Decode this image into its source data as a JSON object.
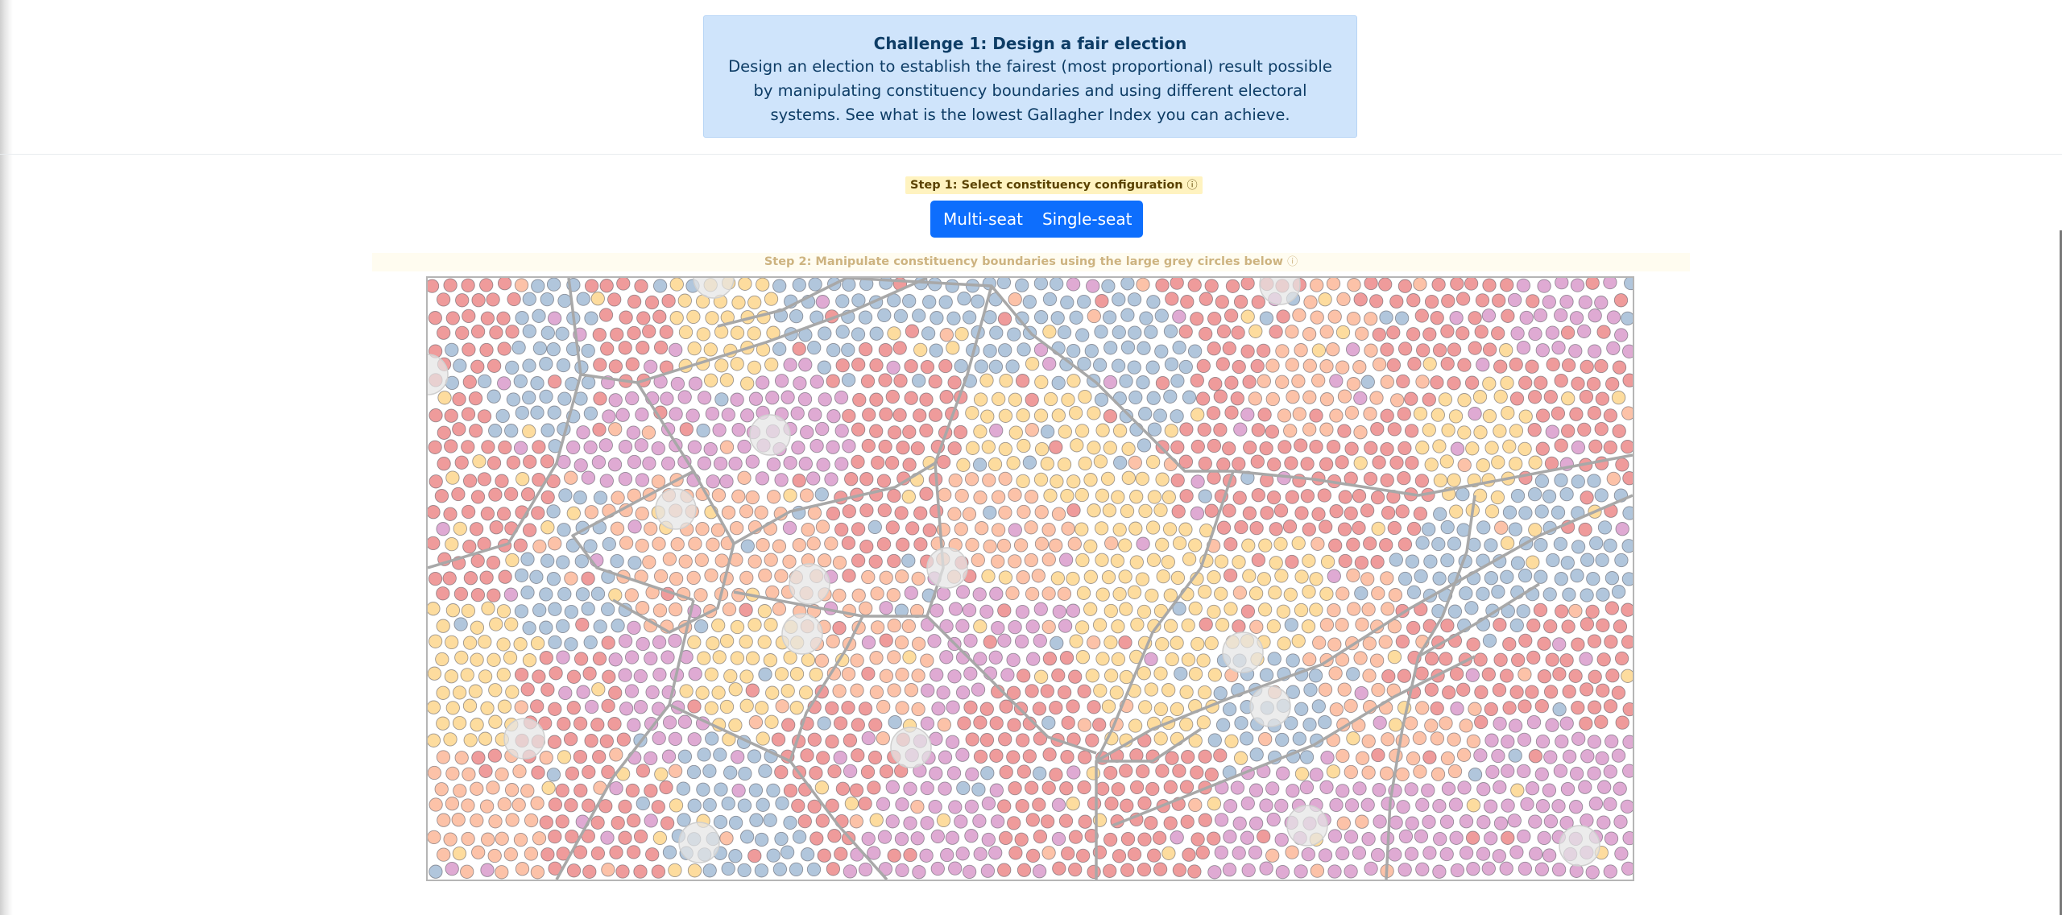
{
  "challenge": {
    "title": "Challenge 1: Design a fair election",
    "description": "Design an election to establish the fairest (most proportional) result possible by manipulating constituency boundaries and using different electoral systems. See what is the lowest Gallagher Index you can achieve."
  },
  "step1": {
    "label": "Step 1: Select constituency configuration",
    "info_glyph": "ⓘ"
  },
  "configuration": {
    "options": [
      "Multi-seat",
      "Single-seat"
    ],
    "multi_label": "Multi-seat",
    "single_label": "Single-seat"
  },
  "step2": {
    "label": "Step 2: Manipulate constituency boundaries using the large grey circles below",
    "info_glyph": "ⓘ"
  },
  "map": {
    "party_colors": {
      "red": "#ef9b9b",
      "blue": "#b1c6dc",
      "yellow": "#fddc9e",
      "peach": "#fcc2a8",
      "purple": "#dfaad3"
    },
    "boundary_color": "#a8a8a8",
    "handle_color": "#e5e5e5"
  }
}
